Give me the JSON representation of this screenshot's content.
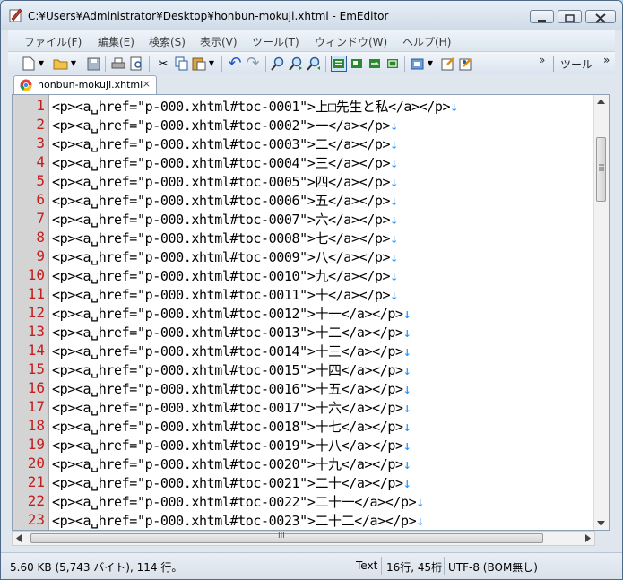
{
  "window": {
    "title": "C:¥Users¥Administrator¥Desktop¥honbun-mokuji.xhtml - EmEditor",
    "buttons": [
      "minimize-button",
      "maximize-button",
      "close-button"
    ]
  },
  "menu": [
    "ファイル(F)",
    "編集(E)",
    "検索(S)",
    "表示(V)",
    "ツール(T)",
    "ウィンドウ(W)",
    "ヘルプ(H)"
  ],
  "toolbar": {
    "icons": [
      "new-file",
      "open-folder",
      "save",
      "print",
      "print-preview",
      "cut",
      "copy",
      "paste",
      "undo",
      "redo",
      "find",
      "find-next",
      "find-prev",
      "layout-1",
      "layout-2",
      "layout-3",
      "layout-4",
      "macro",
      "properties",
      "customize"
    ],
    "overflow": "»",
    "tools_label": "ツール",
    "tools_overflow": "»"
  },
  "tab": {
    "label": "honbun-mokuji.xhtml",
    "close": "×"
  },
  "editor": {
    "eol_mark": "↓",
    "lines": [
      {
        "num": "1",
        "text": "<p><a␣href=\"p-000.xhtml#toc-0001\">上□先生と私</a></p>"
      },
      {
        "num": "2",
        "text": "<p><a␣href=\"p-000.xhtml#toc-0002\">一</a></p>"
      },
      {
        "num": "3",
        "text": "<p><a␣href=\"p-000.xhtml#toc-0003\">二</a></p>"
      },
      {
        "num": "4",
        "text": "<p><a␣href=\"p-000.xhtml#toc-0004\">三</a></p>"
      },
      {
        "num": "5",
        "text": "<p><a␣href=\"p-000.xhtml#toc-0005\">四</a></p>"
      },
      {
        "num": "6",
        "text": "<p><a␣href=\"p-000.xhtml#toc-0006\">五</a></p>"
      },
      {
        "num": "7",
        "text": "<p><a␣href=\"p-000.xhtml#toc-0007\">六</a></p>"
      },
      {
        "num": "8",
        "text": "<p><a␣href=\"p-000.xhtml#toc-0008\">七</a></p>"
      },
      {
        "num": "9",
        "text": "<p><a␣href=\"p-000.xhtml#toc-0009\">八</a></p>"
      },
      {
        "num": "10",
        "text": "<p><a␣href=\"p-000.xhtml#toc-0010\">九</a></p>"
      },
      {
        "num": "11",
        "text": "<p><a␣href=\"p-000.xhtml#toc-0011\">十</a></p>"
      },
      {
        "num": "12",
        "text": "<p><a␣href=\"p-000.xhtml#toc-0012\">十一</a></p>"
      },
      {
        "num": "13",
        "text": "<p><a␣href=\"p-000.xhtml#toc-0013\">十二</a></p>"
      },
      {
        "num": "14",
        "text": "<p><a␣href=\"p-000.xhtml#toc-0014\">十三</a></p>"
      },
      {
        "num": "15",
        "text": "<p><a␣href=\"p-000.xhtml#toc-0015\">十四</a></p>"
      },
      {
        "num": "16",
        "text": "<p><a␣href=\"p-000.xhtml#toc-0016\">十五</a></p>"
      },
      {
        "num": "17",
        "text": "<p><a␣href=\"p-000.xhtml#toc-0017\">十六</a></p>"
      },
      {
        "num": "18",
        "text": "<p><a␣href=\"p-000.xhtml#toc-0018\">十七</a></p>"
      },
      {
        "num": "19",
        "text": "<p><a␣href=\"p-000.xhtml#toc-0019\">十八</a></p>"
      },
      {
        "num": "20",
        "text": "<p><a␣href=\"p-000.xhtml#toc-0020\">十九</a></p>"
      },
      {
        "num": "21",
        "text": "<p><a␣href=\"p-000.xhtml#toc-0021\">二十</a></p>"
      },
      {
        "num": "22",
        "text": "<p><a␣href=\"p-000.xhtml#toc-0022\">二十一</a></p>"
      },
      {
        "num": "23",
        "text": "<p><a␣href=\"p-000.xhtml#toc-0023\">二十二</a></p>"
      }
    ]
  },
  "hscroll_thumb_label": "III",
  "status": {
    "size": "5.60 KB (5,743 バイト), 114 行。",
    "mode": "Text",
    "position": "16行, 45桁",
    "encoding": "UTF-8 (BOM無し)"
  }
}
